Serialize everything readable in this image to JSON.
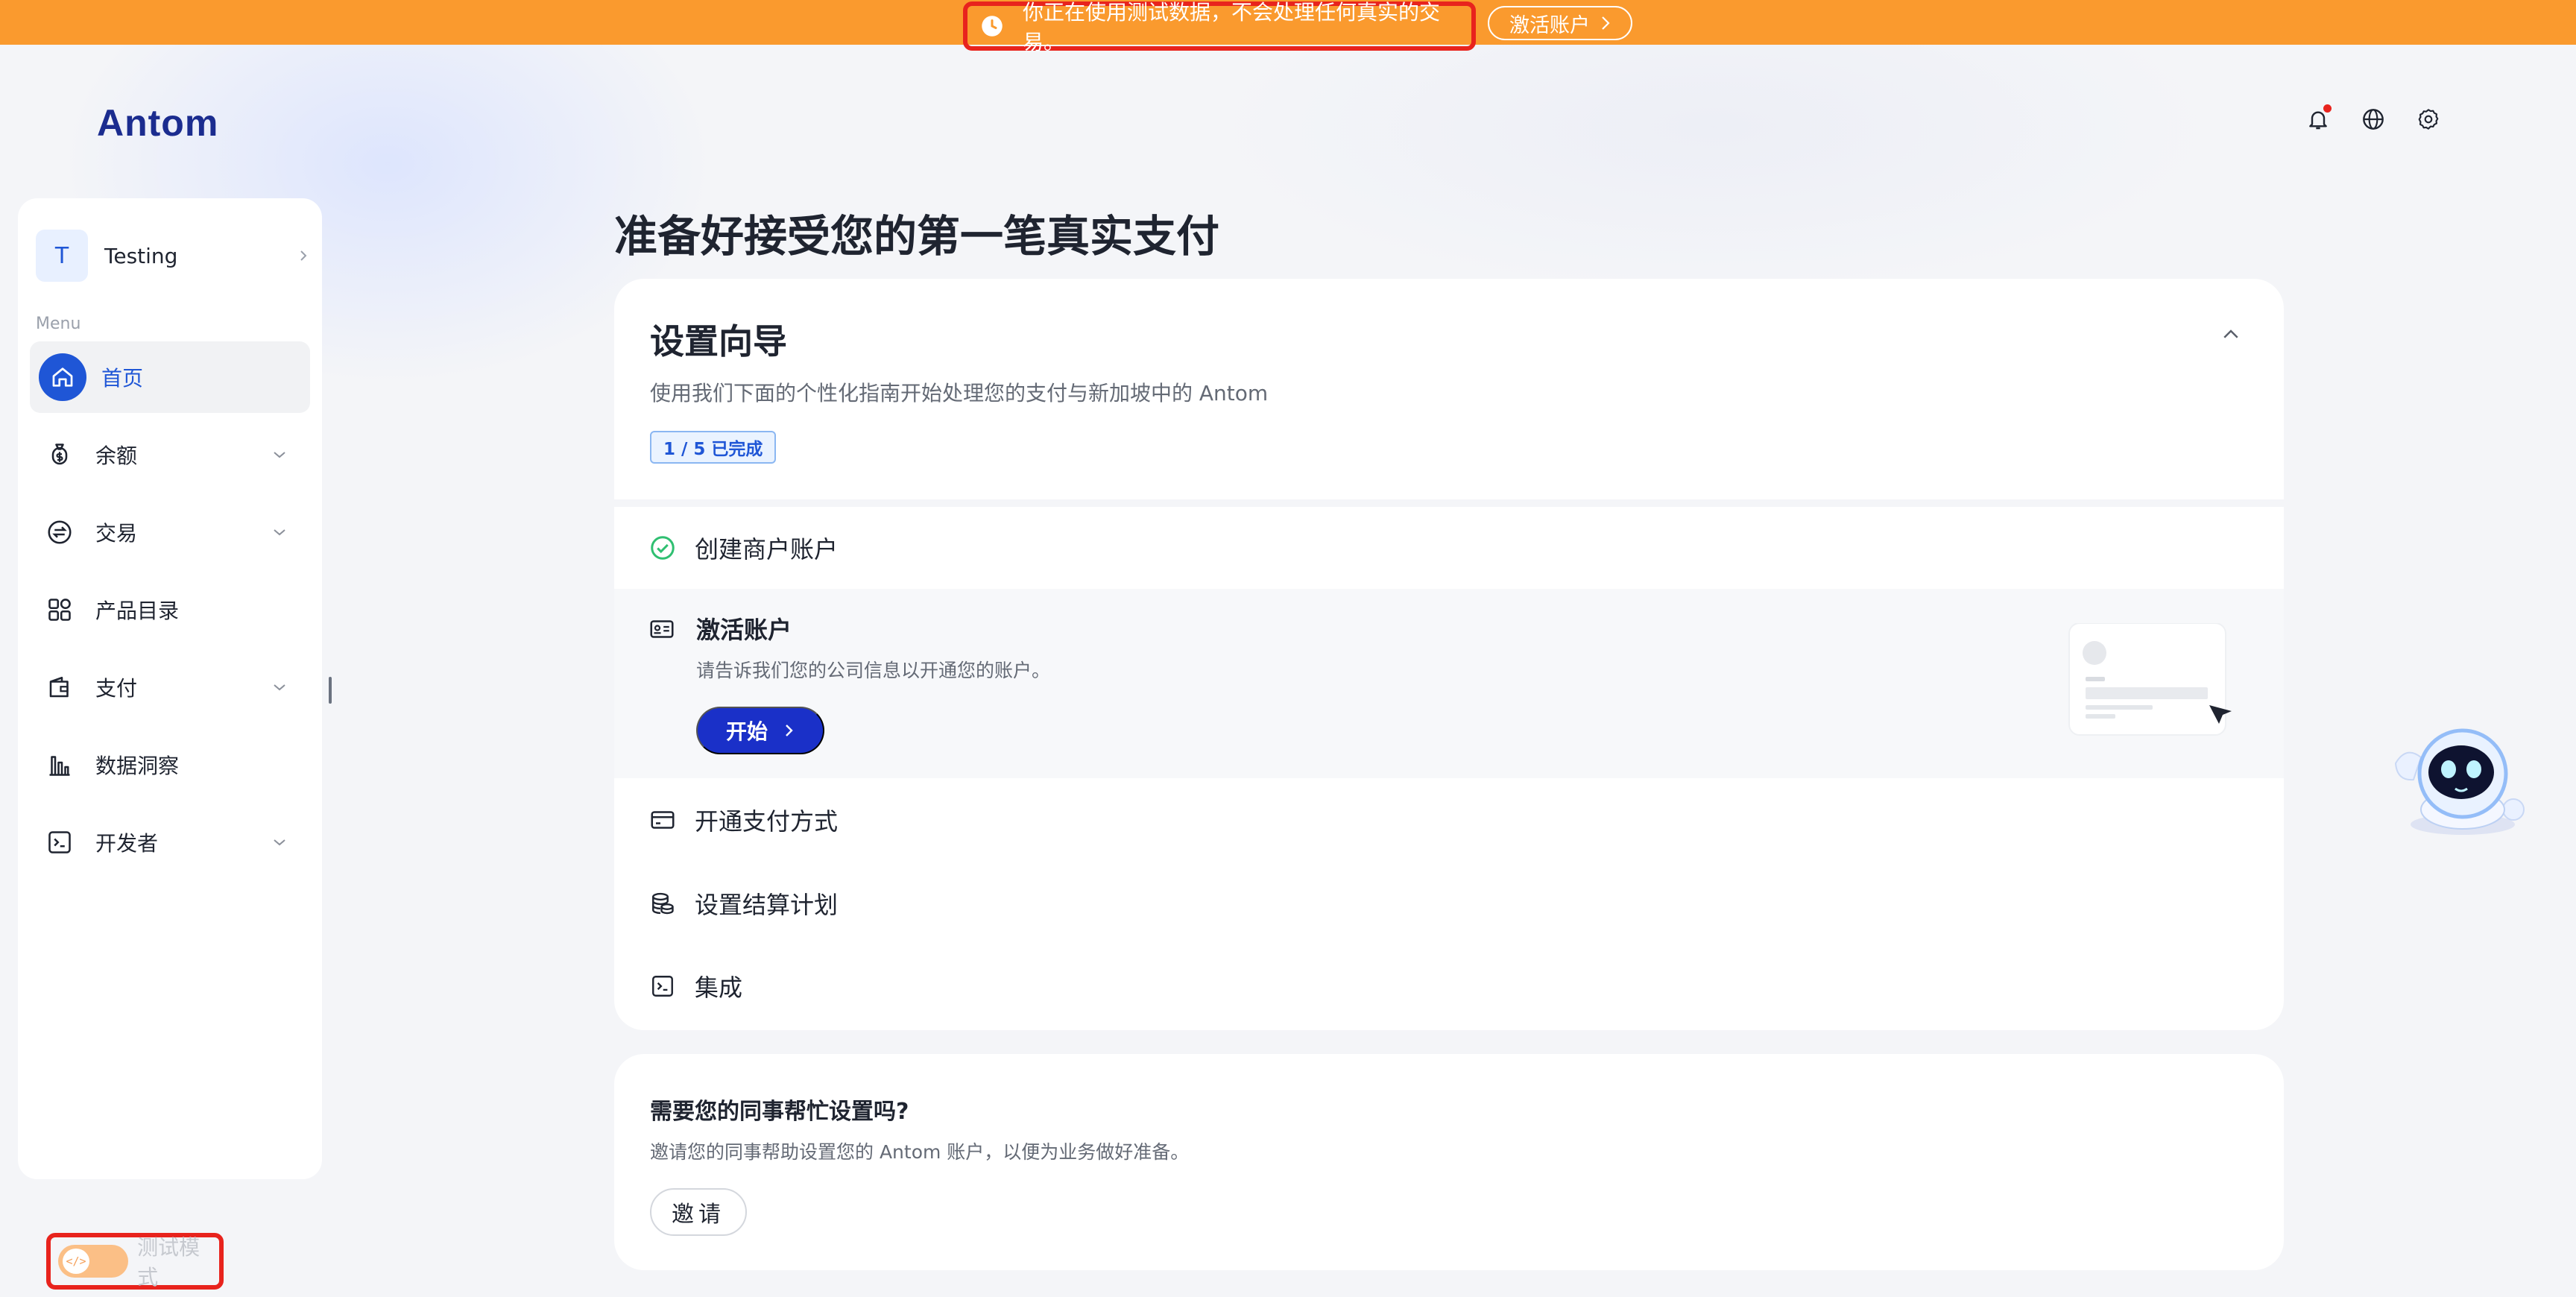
{
  "banner": {
    "message": "你正在使用测试数据，不会处理任何真实的交易。",
    "activate_label": "激活账户"
  },
  "header": {
    "logo": "Antom",
    "icons": [
      "bell-icon",
      "globe-icon",
      "gear-icon"
    ]
  },
  "sidebar": {
    "account": {
      "avatar_letter": "T",
      "name": "Testing"
    },
    "menu_label": "Menu",
    "items": [
      {
        "label": "首页",
        "icon": "home-icon",
        "active": true,
        "expandable": false
      },
      {
        "label": "余额",
        "icon": "money-bag-icon",
        "active": false,
        "expandable": true
      },
      {
        "label": "交易",
        "icon": "exchange-icon",
        "active": false,
        "expandable": true
      },
      {
        "label": "产品目录",
        "icon": "grid-icon",
        "active": false,
        "expandable": false
      },
      {
        "label": "支付",
        "icon": "wallet-icon",
        "active": false,
        "expandable": true
      },
      {
        "label": "数据洞察",
        "icon": "bar-chart-icon",
        "active": false,
        "expandable": false
      },
      {
        "label": "开发者",
        "icon": "terminal-icon",
        "active": false,
        "expandable": true
      }
    ],
    "test_mode_label": "测试模式",
    "test_mode_on": false
  },
  "main": {
    "page_title": "准备好接受您的第一笔真实支付",
    "wizard": {
      "title": "设置向导",
      "subtitle": "使用我们下面的个性化指南开始处理您的支付与新加坡中的 Antom",
      "progress": "1 / 5 已完成",
      "steps": [
        {
          "label": "创建商户账户",
          "icon": "check-circle-icon",
          "status": "done"
        },
        {
          "label": "激活账户",
          "icon": "id-card-icon",
          "status": "active",
          "description": "请告诉我们您的公司信息以开通您的账户。",
          "button": "开始"
        },
        {
          "label": "开通支付方式",
          "icon": "credit-card-icon",
          "status": "todo"
        },
        {
          "label": "设置结算计划",
          "icon": "coins-icon",
          "status": "todo"
        },
        {
          "label": "集成",
          "icon": "terminal-icon",
          "status": "todo"
        }
      ]
    },
    "invite": {
      "title": "需要您的同事帮忙设置吗?",
      "description": "邀请您的同事帮助设置您的 Antom 账户，以便为业务做好准备。",
      "button": "邀请"
    }
  },
  "colors": {
    "banner": "#fa9a2e",
    "primary": "#1f56d6",
    "start_button": "#1a30c8",
    "success": "#2fbf71",
    "highlight_border": "#e8231d"
  }
}
